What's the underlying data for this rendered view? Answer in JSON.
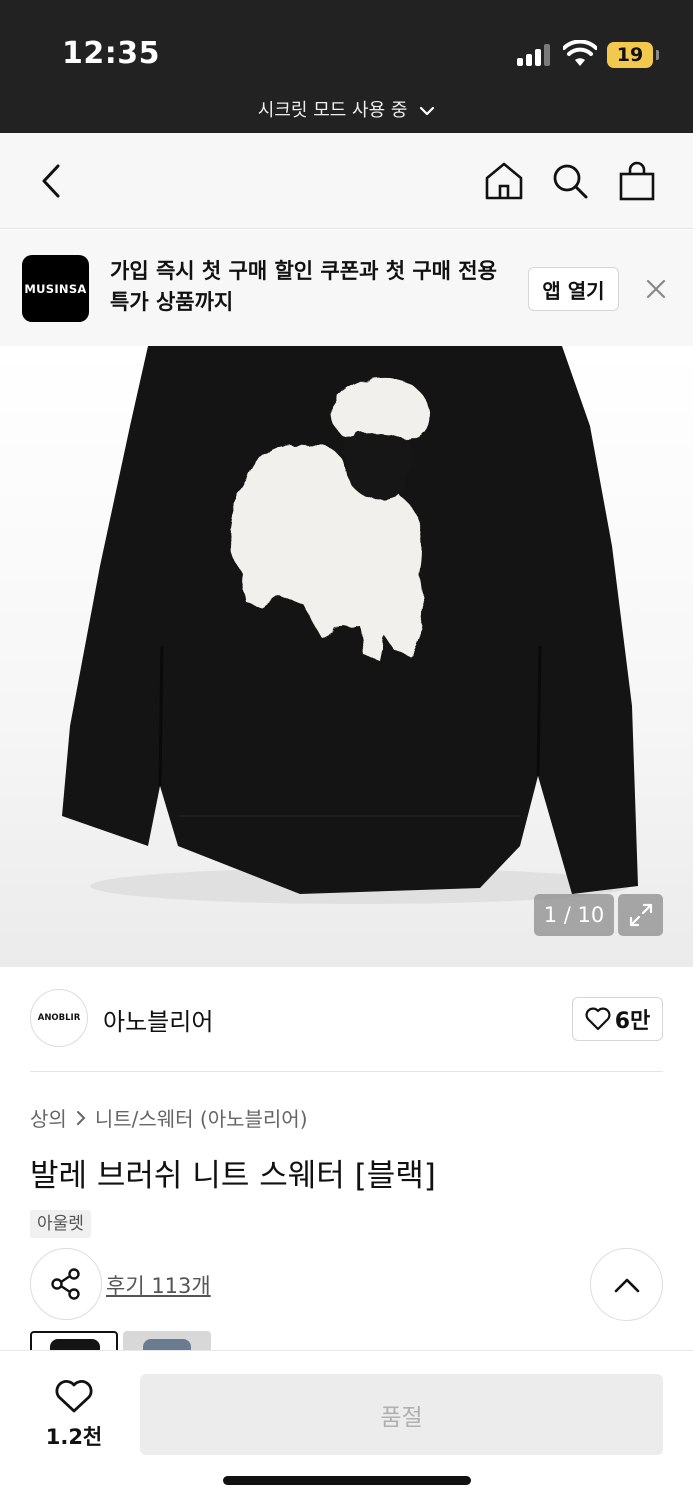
{
  "status_bar": {
    "time": "12:35",
    "battery": "19",
    "incognito_label": "시크릿 모드 사용 중"
  },
  "banner": {
    "logo_text": "MUSINSA",
    "message": "가입 즉시 첫 구매 할인 쿠폰과 첫 구매 전용 특가 상품까지",
    "open_app_label": "앱 열기"
  },
  "gallery": {
    "counter": "1 / 10"
  },
  "brand": {
    "logo_text": "ANOBLIR",
    "name": "아노블리어",
    "likes": "6만"
  },
  "breadcrumb": {
    "category": "상의",
    "subcategory": "니트/스웨터 (아노블리어)"
  },
  "product": {
    "title": "발레 브러쉬 니트 스웨터 [블랙]",
    "tag": "아울렛",
    "reviews": "후기 113개"
  },
  "bottom_bar": {
    "wish_count": "1.2천",
    "buy_label": "품절"
  },
  "colors": {
    "status_bar_bg": "#222222",
    "battery": "#f2c94c",
    "sold_out_bg": "#ececec"
  }
}
